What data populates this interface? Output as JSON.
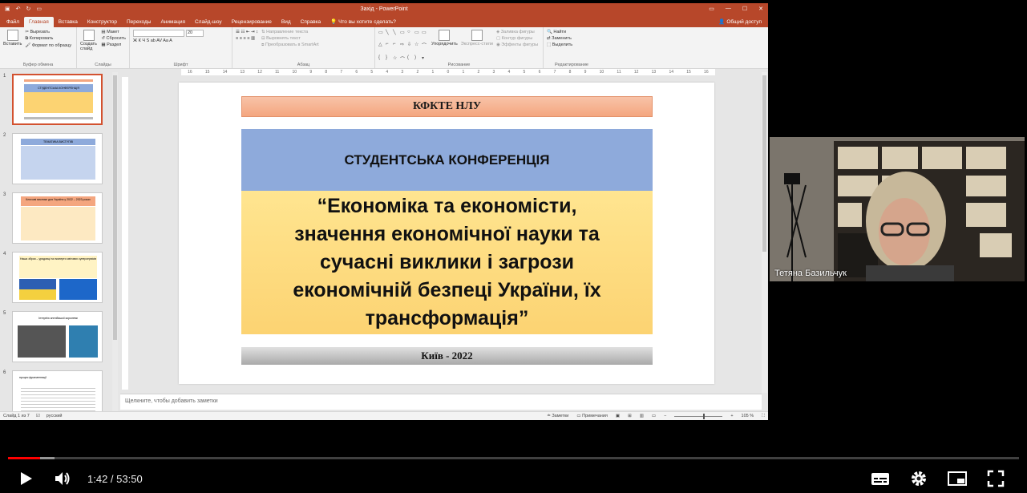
{
  "ppt": {
    "title": "Захід  -  PowerPoint",
    "tabs": [
      "Файл",
      "Главная",
      "Вставка",
      "Конструктор",
      "Переходы",
      "Анимация",
      "Слайд-шоу",
      "Рецензирование",
      "Вид",
      "Справка"
    ],
    "active_tab": "Главная",
    "tell_me": "Что вы хотите сделать?",
    "share": "Общий доступ",
    "ribbon": {
      "paste": "Вставить",
      "cut": "Вырезать",
      "copy": "Копировать",
      "format_painter": "Формат по образцу",
      "new_slide": "Создать слайд",
      "layout": "Макет",
      "reset": "Сбросить",
      "section": "Раздел",
      "font_size": "20",
      "text_direction": "Направление текста",
      "align_text": "Выровнять текст",
      "smartart": "Преобразовать в SmartArt",
      "arrange": "Упорядочить",
      "quick_styles": "Экспресс-стили",
      "shape_fill": "Заливка фигуры",
      "shape_outline": "Контур фигуры",
      "shape_effects": "Эффекты фигуры",
      "find": "Найти",
      "replace": "Заменить",
      "select": "Выделить",
      "groups": [
        "Буфер обмена",
        "Слайды",
        "Шрифт",
        "Абзац",
        "Рисование",
        "Редактирование"
      ]
    },
    "thumbnails": [
      {
        "num": "1",
        "title": "СТУДЕНТСЬКА КОНФЕРЕНЦІЯ"
      },
      {
        "num": "2",
        "title": "ТЕМАТИКА ВИСТУПІВ"
      },
      {
        "num": "3",
        "title": "Ключові виклики для України у 2022 – 2023 роках"
      },
      {
        "num": "4",
        "title": "Наша зброя – урядовці та експерти світових суперсервісів"
      },
      {
        "num": "5",
        "title": "Інтерв'ю англійської королеви"
      },
      {
        "num": "6",
        "title": "процес фрагментації"
      }
    ],
    "slide": {
      "header": "КФКТЕ НЛУ",
      "conference": "СТУДЕНТСЬКА КОНФЕРЕНЦІЯ",
      "topic_lines": [
        "“Економіка та економісти,",
        "значення економічної науки та",
        "сучасні виклики і загрози",
        "економічній безпеці України, їх",
        "трансформація”"
      ],
      "footer": "Київ - 2022"
    },
    "notes_placeholder": "Щелкните, чтобы добавить заметки",
    "status": {
      "slide_count": "Слайд 1 из 7",
      "language": "русский",
      "notes": "Заметки",
      "comments": "Примечания",
      "zoom": "105 %"
    }
  },
  "camera": {
    "name": "Тетяна Базильчук"
  },
  "player": {
    "time_current": "1:42",
    "time_total": "53:50",
    "time_display": "1:42 / 53:50",
    "progress_fraction": 0.032
  },
  "colors": {
    "ppt_accent": "#b7472a",
    "progress_red": "#ff0000"
  }
}
